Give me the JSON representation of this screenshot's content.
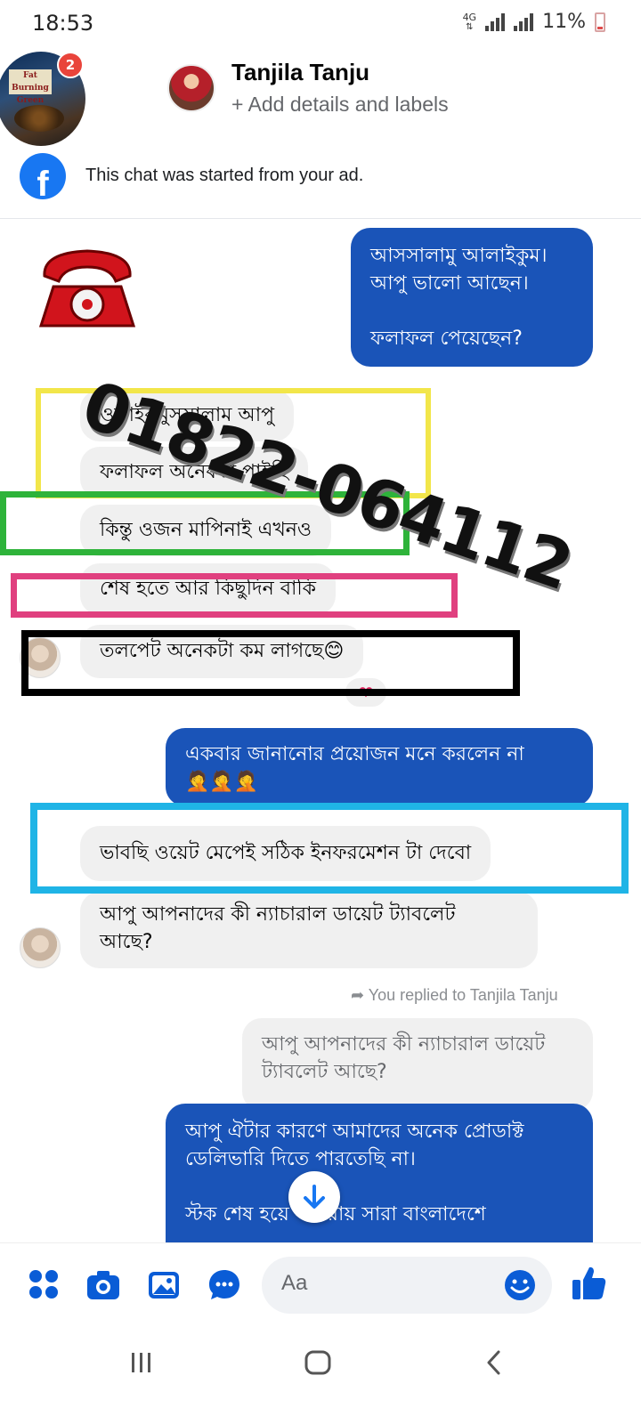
{
  "status_bar": {
    "time": "18:53",
    "network": "4G",
    "battery": "11%"
  },
  "header": {
    "ad_badge_count": "2",
    "ad_thumb_text": "Fat Burning Green TEA",
    "contact_name": "Tanjila Tanju",
    "subtitle": "+ Add details and labels"
  },
  "ad_banner": {
    "icon": "facebook-icon",
    "text": "This chat was started from your ad."
  },
  "overlay": {
    "phone_number": "01822-064112",
    "phone_icon": "telephone-icon"
  },
  "messages": [
    {
      "id": "m1",
      "direction": "outgoing",
      "text": "আসসালামু আলাইকুম।\nআপু ভালো আছেন।\n\nফলাফল পেয়েছেন?"
    },
    {
      "id": "m2",
      "direction": "incoming",
      "text": "ওলাইকুমুসসালাম আপু"
    },
    {
      "id": "m3",
      "direction": "incoming",
      "text": "ফলাফল অনেকটা পাইছি"
    },
    {
      "id": "m4",
      "direction": "incoming",
      "text": "কিন্তু ওজন মাপিনাই এখনও"
    },
    {
      "id": "m5",
      "direction": "incoming",
      "text": "শেষ হতে আর কিছুদিন বাকি"
    },
    {
      "id": "m6",
      "direction": "incoming",
      "text": "তলপেট অনেকটা কম লাগছে😊",
      "reaction": "❤"
    },
    {
      "id": "m7",
      "direction": "outgoing",
      "text": "একবার জানানোর প্রয়োজন মনে করলেন না\n🤦🤦🤦"
    },
    {
      "id": "m8",
      "direction": "incoming",
      "text": "ভাবছি ওয়েট মেপেই সঠিক ইনফরমেশন টা দেবো"
    },
    {
      "id": "m9",
      "direction": "incoming",
      "text": "আপু আপনাদের কী ন্যাচারাল ডায়েট ট্যাবলেট\nআছে?"
    },
    {
      "id": "m10",
      "direction": "outgoing",
      "text": "আপু ঐটার কারণে আমাদের অনেক প্রোডাক্ট\nডেলিভারি দিতে পারতেছি না।\n\nস্টক শেষ হয়ে যাওয়ায় সারা বাংলাদেশে"
    }
  ],
  "reply_context": {
    "label": "You replied to Tanjila Tanju",
    "quoted_text": "আপু আপনাদের কী ন্যাচারাল ডায়েট\nট্যাবলেট আছে?"
  },
  "composer": {
    "placeholder": "Aa",
    "icons": [
      "menu-dots-icon",
      "camera-icon",
      "gallery-icon",
      "sticker-icon",
      "emoji-icon",
      "like-icon"
    ]
  },
  "colors": {
    "outgoing_bubble": "#1a54b8",
    "incoming_bubble": "#f0f0f0",
    "messenger_blue": "#1877f2",
    "box_yellow": "#f2e64a",
    "box_green": "#2eb33a",
    "box_pink": "#e0407f",
    "box_black": "#000000",
    "box_cyan": "#1fb4e6"
  }
}
